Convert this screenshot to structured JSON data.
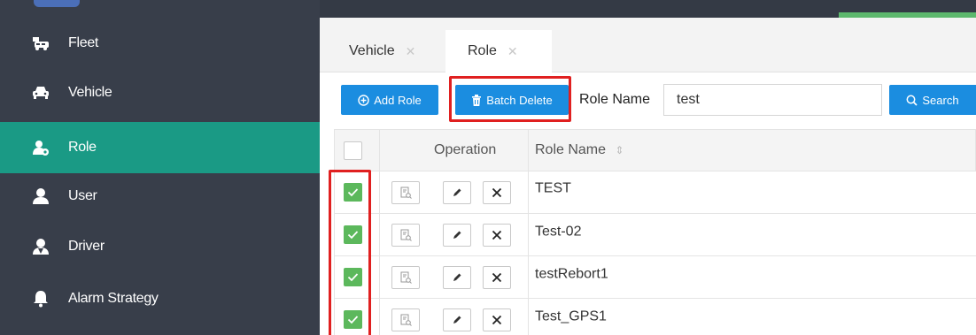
{
  "sidebar": {
    "items": [
      {
        "label": "Fleet",
        "icon": "fleet-icon"
      },
      {
        "label": "Vehicle",
        "icon": "car-icon"
      },
      {
        "label": "Role",
        "icon": "role-icon",
        "active": true
      },
      {
        "label": "User",
        "icon": "user-icon"
      },
      {
        "label": "Driver",
        "icon": "driver-icon"
      },
      {
        "label": "Alarm Strategy",
        "icon": "bell-icon"
      }
    ]
  },
  "tabs": [
    {
      "label": "Vehicle",
      "active": false
    },
    {
      "label": "Role",
      "active": true
    }
  ],
  "toolbar": {
    "add_label": "Add Role",
    "batch_delete_label": "Batch Delete",
    "role_name_label": "Role Name",
    "role_name_value": "test",
    "search_label": "Search"
  },
  "table": {
    "headers": {
      "operation": "Operation",
      "role_name": "Role Name"
    },
    "rows": [
      {
        "role_name": "TEST",
        "checked": true
      },
      {
        "role_name": "Test-02",
        "checked": true
      },
      {
        "role_name": "testRebort1",
        "checked": true
      },
      {
        "role_name": "Test_GPS1",
        "checked": true
      }
    ]
  },
  "colors": {
    "sidebar_bg": "#383e4a",
    "active_item": "#1a9a85",
    "button_blue": "#1b8de0",
    "check_green": "#5cb85c",
    "highlight_red": "#e02020"
  }
}
